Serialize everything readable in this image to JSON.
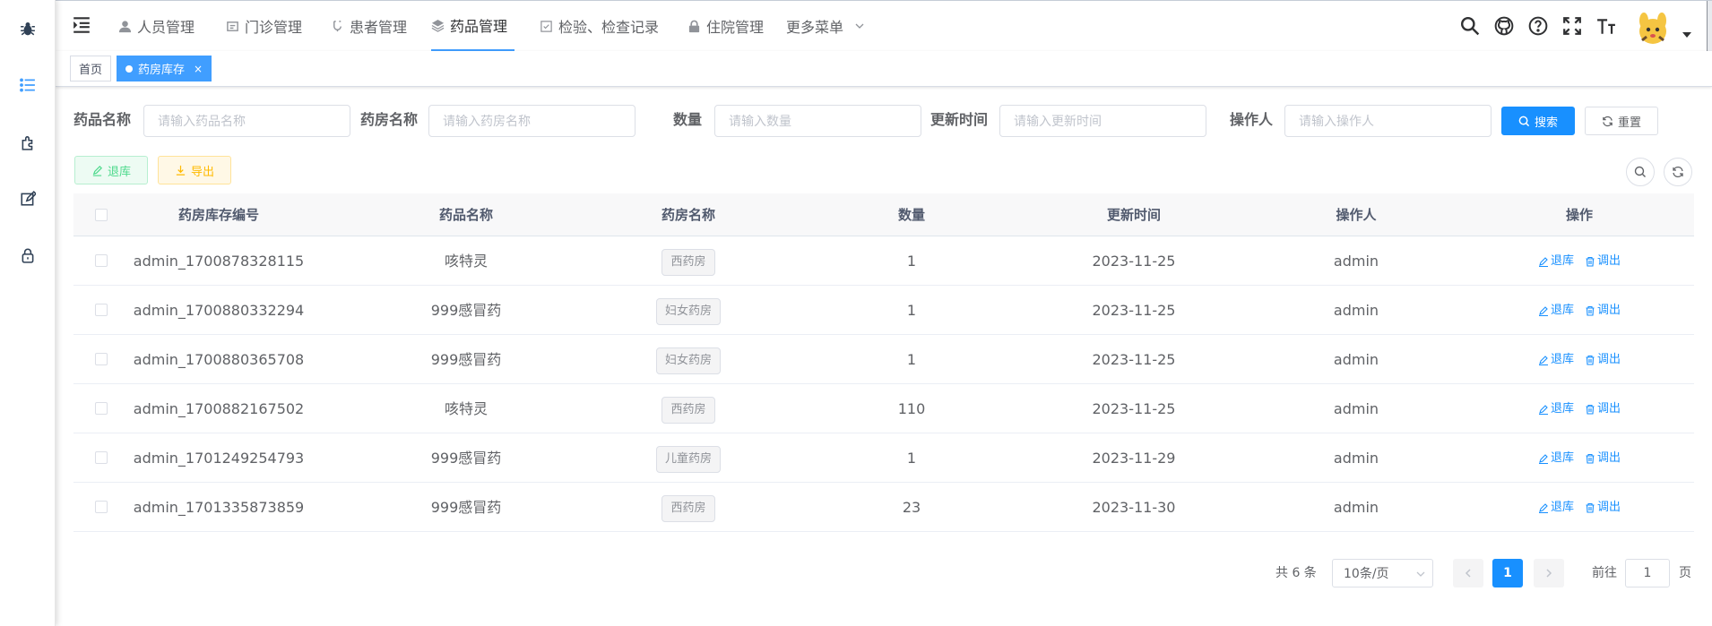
{
  "sidebar": {
    "icons": [
      "bug-icon",
      "list-icon",
      "puzzle-icon",
      "edit-icon",
      "lock-icon"
    ]
  },
  "navbar": {
    "menu": [
      {
        "label": "人员管理",
        "icon": "user-icon"
      },
      {
        "label": "门诊管理",
        "icon": "clinic-icon"
      },
      {
        "label": "患者管理",
        "icon": "patient-icon"
      },
      {
        "label": "药品管理",
        "icon": "layers-icon",
        "active": true
      },
      {
        "label": "检验、检查记录",
        "icon": "checkbox-icon"
      },
      {
        "label": "住院管理",
        "icon": "lock-icon"
      },
      {
        "label": "更多菜单",
        "icon": "chevron-down-icon"
      }
    ],
    "right_icons": [
      "search-icon",
      "github-icon",
      "question-icon",
      "fullscreen-icon",
      "font-size-icon"
    ]
  },
  "tags": [
    {
      "label": "首页"
    },
    {
      "label": "药房库存",
      "active": true,
      "close": "×"
    }
  ],
  "search_form": {
    "drug_name": {
      "label": "药品名称",
      "placeholder": "请输入药品名称"
    },
    "pharmacy_name": {
      "label": "药房名称",
      "placeholder": "请输入药房名称"
    },
    "quantity": {
      "label": "数量",
      "placeholder": "请输入数量"
    },
    "update_time": {
      "label": "更新时间",
      "placeholder": "请输入更新时间"
    },
    "operator": {
      "label": "操作人",
      "placeholder": "请输入操作人"
    },
    "search_button": "搜索",
    "reset_button": "重置"
  },
  "toolbar": {
    "return_button": "退库",
    "export_button": "导出"
  },
  "table": {
    "columns": [
      "药房库存编号",
      "药品名称",
      "药房名称",
      "数量",
      "更新时间",
      "操作人",
      "操作"
    ],
    "rows": [
      {
        "id": "admin_1700878328115",
        "drug": "咳特灵",
        "pharmacy": "西药房",
        "qty": "1",
        "time": "2023-11-25",
        "operator": "admin"
      },
      {
        "id": "admin_1700880332294",
        "drug": "999感冒药",
        "pharmacy": "妇女药房",
        "qty": "1",
        "time": "2023-11-25",
        "operator": "admin"
      },
      {
        "id": "admin_1700880365708",
        "drug": "999感冒药",
        "pharmacy": "妇女药房",
        "qty": "1",
        "time": "2023-11-25",
        "operator": "admin"
      },
      {
        "id": "admin_1700882167502",
        "drug": "咳特灵",
        "pharmacy": "西药房",
        "qty": "110",
        "time": "2023-11-25",
        "operator": "admin"
      },
      {
        "id": "admin_1701249254793",
        "drug": "999感冒药",
        "pharmacy": "儿童药房",
        "qty": "1",
        "time": "2023-11-29",
        "operator": "admin"
      },
      {
        "id": "admin_1701335873859",
        "drug": "999感冒药",
        "pharmacy": "西药房",
        "qty": "23",
        "time": "2023-11-30",
        "operator": "admin"
      }
    ],
    "op_return": "退库",
    "op_transfer": "调出"
  },
  "pagination": {
    "total": "共 6 条",
    "page_size": "10条/页",
    "current_page": "1",
    "goto_prefix": "前往",
    "goto_value": "1",
    "goto_suffix": "页"
  },
  "colors": {
    "primary": "#1890ff",
    "success": "#13ce66",
    "warning": "#ffba00"
  }
}
